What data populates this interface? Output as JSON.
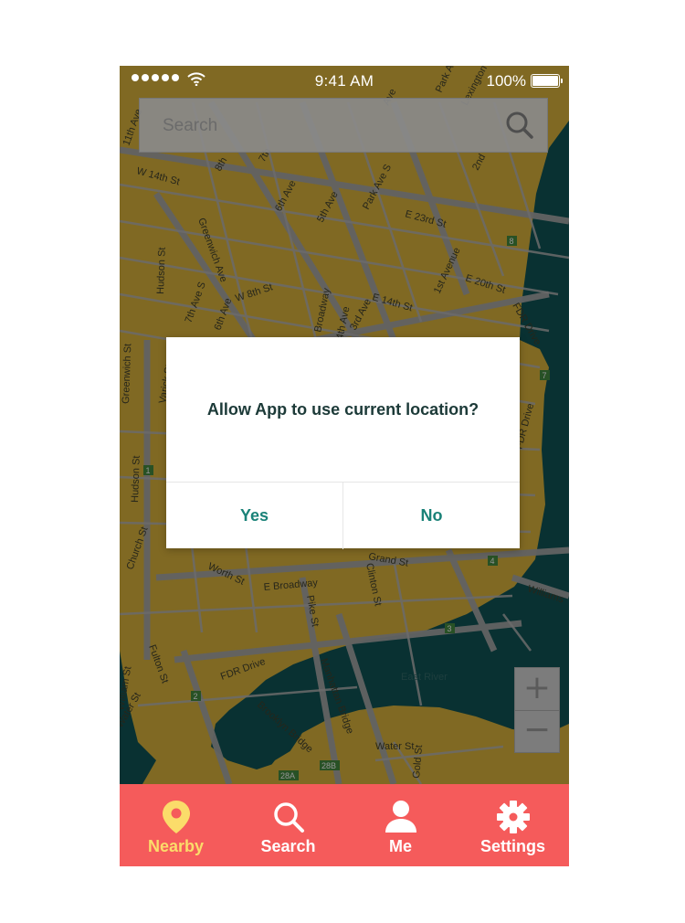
{
  "status_bar": {
    "time": "9:41 AM",
    "battery": "100%"
  },
  "search": {
    "placeholder": "Search"
  },
  "map": {
    "streets": [
      "11th Ave",
      "W 14th St",
      "8th",
      "7th",
      "Hudson St",
      "Greenwich Ave",
      "6th Ave",
      "5th Ave",
      "Park Ave S",
      "Park Ave",
      "Lexington",
      "2nd",
      "E 23rd St",
      "W 8th St",
      "7th Ave S",
      "6th Ave",
      "Broadway",
      "4th Ave",
      "3rd Ave",
      "E 14th St",
      "1st Avenue",
      "E 20th St",
      "FDR Drive",
      "FDR Drive",
      "Greenwich St",
      "Varick St",
      "Hudson St",
      "Church St",
      "Worth St",
      "E Broadway",
      "Clinton St",
      "Grand St",
      "Pike St",
      "Williams",
      "Fulton St",
      "William St",
      "Water St",
      "FDR Drive",
      "Brooklyn Bridge",
      "Manhattan Bridge",
      "Water St",
      "Gold St",
      "East River",
      "Ave"
    ],
    "markers": [
      "8",
      "7",
      "1",
      "4",
      "3",
      "2",
      "28A",
      "28B"
    ]
  },
  "dialog": {
    "message": "Allow App to use current location?",
    "yes_label": "Yes",
    "no_label": "No"
  },
  "zoom": {
    "in_label": "+",
    "out_label": "−"
  },
  "tabs": [
    {
      "label": "Nearby",
      "icon": "map-pin-icon",
      "active": true
    },
    {
      "label": "Search",
      "icon": "search-icon",
      "active": false
    },
    {
      "label": "Me",
      "icon": "person-icon",
      "active": false
    },
    {
      "label": "Settings",
      "icon": "gear-icon",
      "active": false
    }
  ],
  "colors": {
    "tab_bar": "#f55b5b",
    "active_tab": "#fbdc6a",
    "map_land": "#c9a538",
    "map_water": "#0f4e4f",
    "dialog_button": "#1a8278",
    "dialog_text": "#1c3a38"
  }
}
